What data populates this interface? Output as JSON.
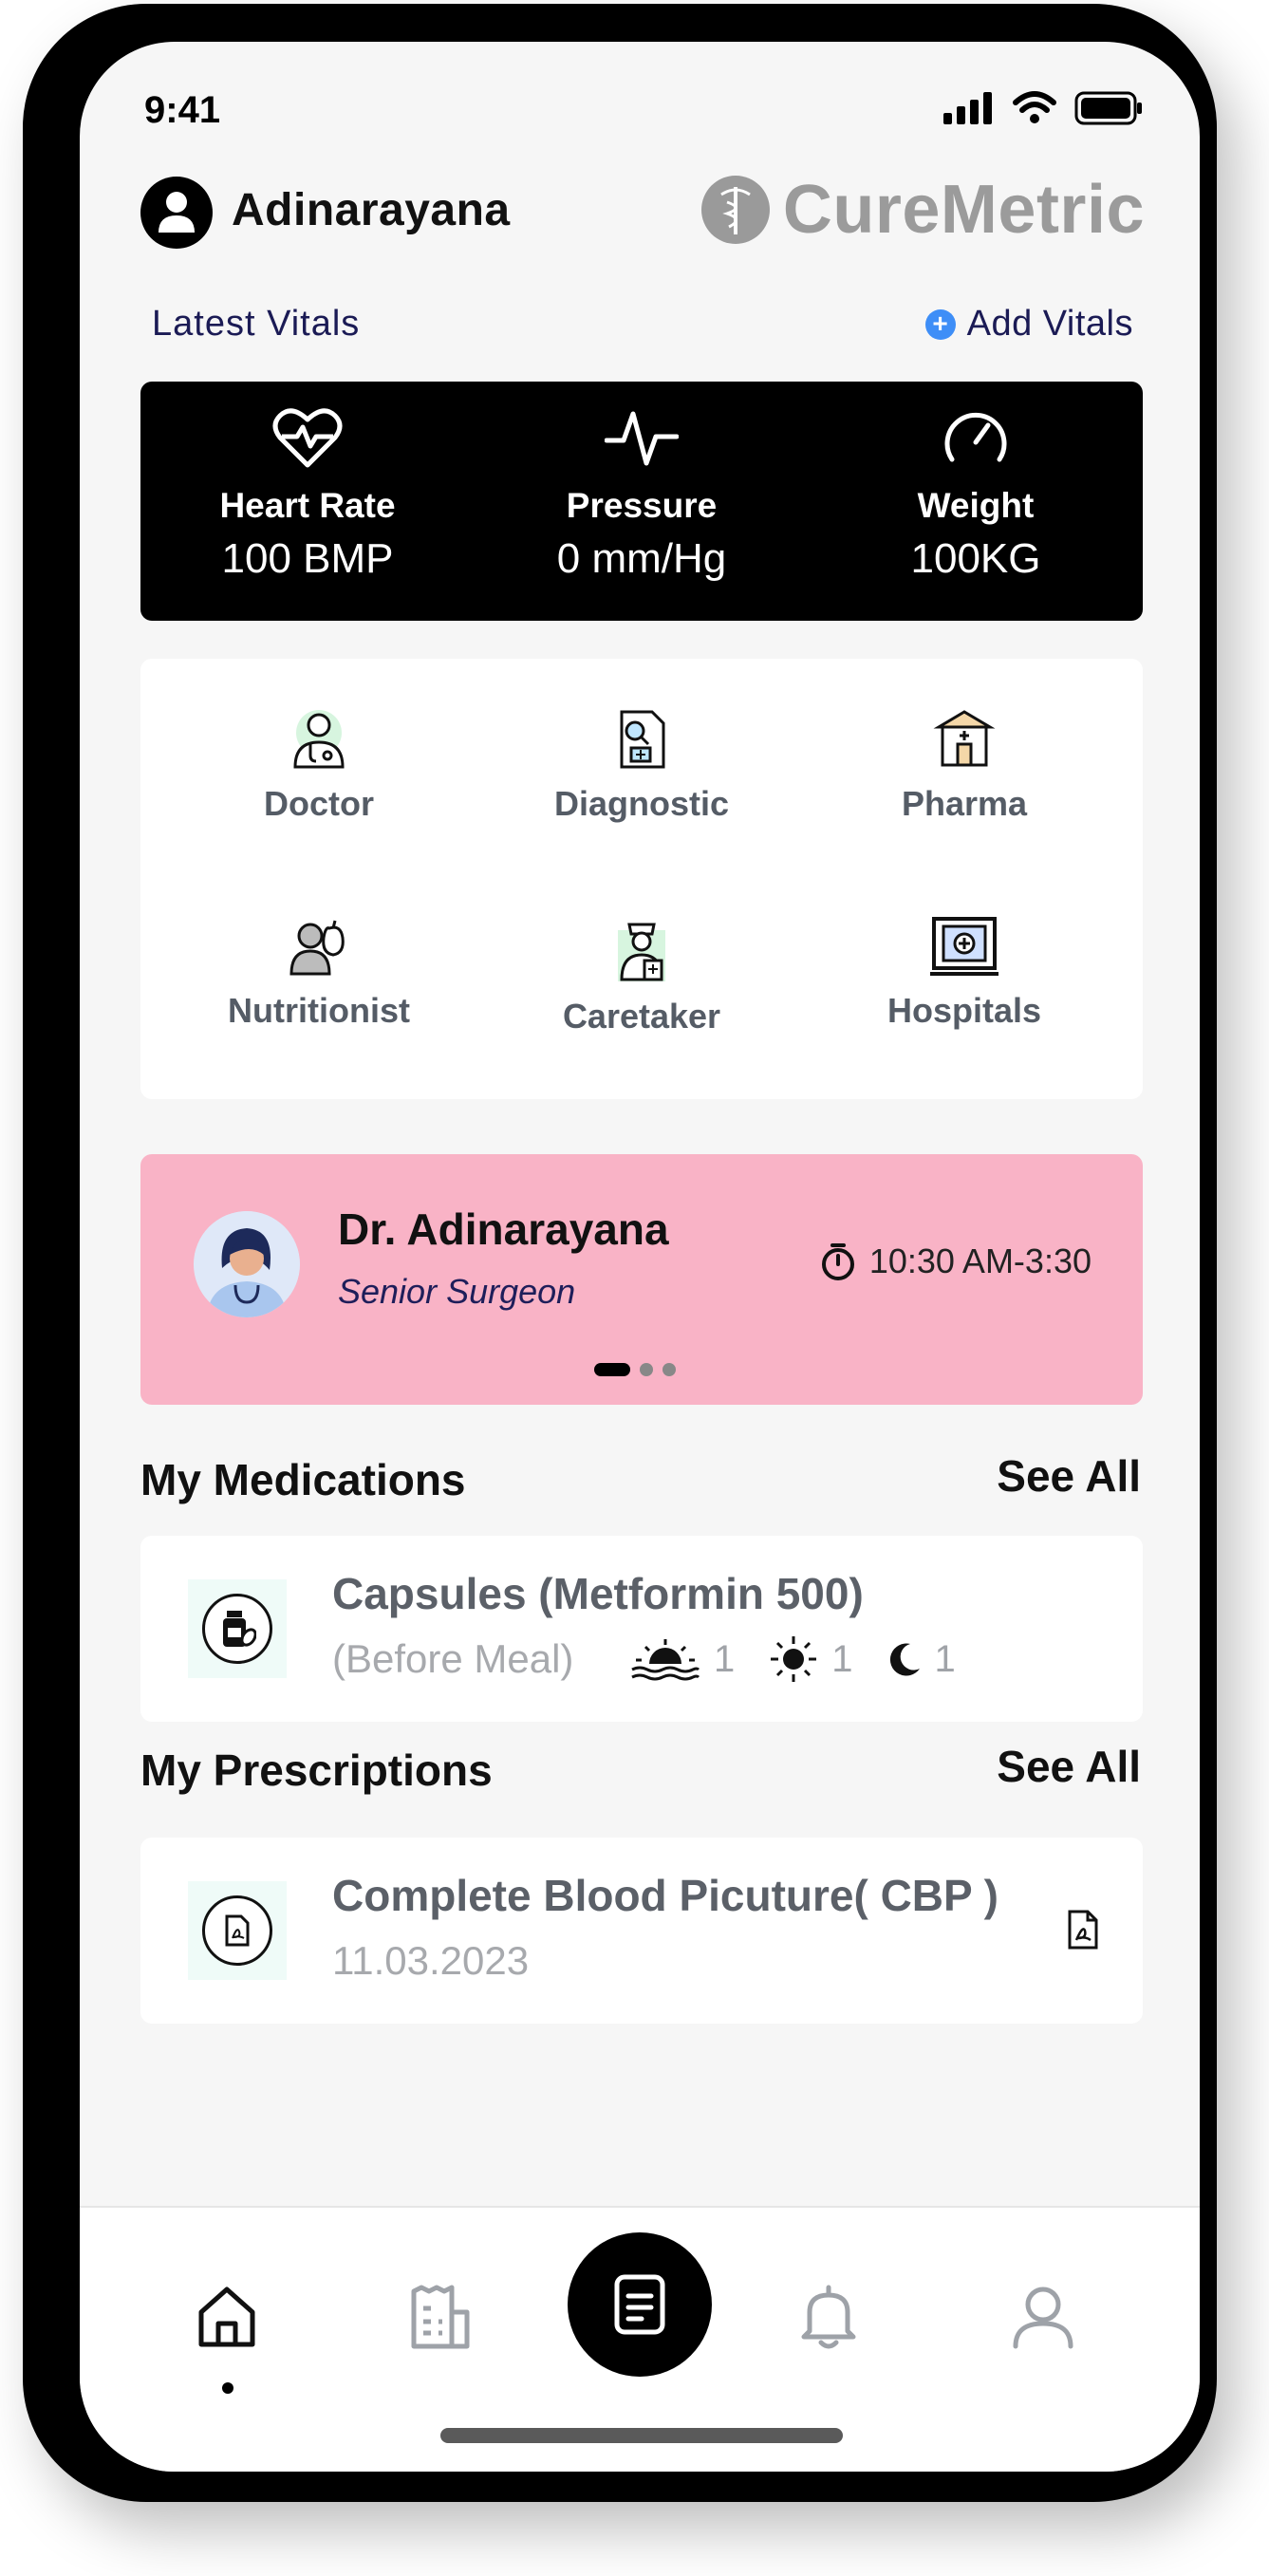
{
  "status_bar": {
    "time": "9:41"
  },
  "header": {
    "user_name": "Adinarayana",
    "brand_name": "CureMetric"
  },
  "vitals_section": {
    "title": "Latest Vitals",
    "add_label": "Add Vitals"
  },
  "vitals": [
    {
      "label": "Heart Rate",
      "value": "100 BMP",
      "icon": "heart-pulse-icon"
    },
    {
      "label": "Pressure",
      "value": "0 mm/Hg",
      "icon": "pulse-wave-icon"
    },
    {
      "label": "Weight",
      "value": "100KG",
      "icon": "gauge-icon"
    }
  ],
  "services": [
    {
      "label": "Doctor",
      "icon": "doctor-icon"
    },
    {
      "label": "Diagnostic",
      "icon": "diagnostic-report-icon"
    },
    {
      "label": "Pharma",
      "icon": "pharmacy-store-icon"
    },
    {
      "label": "Nutritionist",
      "icon": "nutritionist-icon"
    },
    {
      "label": "Caretaker",
      "icon": "caretaker-nurse-icon"
    },
    {
      "label": "Hospitals",
      "icon": "hospital-icon"
    }
  ],
  "doctor_card": {
    "name": "Dr. Adinarayana",
    "role": "Senior Surgeon",
    "time": "10:30 AM-3:30",
    "background": "#f9b3c6"
  },
  "medications": {
    "title": "My Medications",
    "see_all": "See All",
    "item": {
      "name": "Capsules (Metformin 500)",
      "timing": "(Before Meal)",
      "morning": "1",
      "afternoon": "1",
      "night": "1"
    }
  },
  "prescriptions": {
    "title": "My Prescriptions",
    "see_all": "See All",
    "item": {
      "name": "Complete Blood Picuture( CBP )",
      "date": "11.03.2023"
    }
  },
  "bottom_nav": [
    {
      "name": "home-icon",
      "active": true
    },
    {
      "name": "reports-icon",
      "active": false
    },
    {
      "name": "document-icon",
      "active": false
    },
    {
      "name": "bell-icon",
      "active": false
    },
    {
      "name": "profile-icon",
      "active": false
    }
  ],
  "colors": {
    "accent": "#3e8ef7",
    "dark": "#000000",
    "pink_card": "#f9b3c6",
    "brand_gray": "#9b9b9b"
  }
}
